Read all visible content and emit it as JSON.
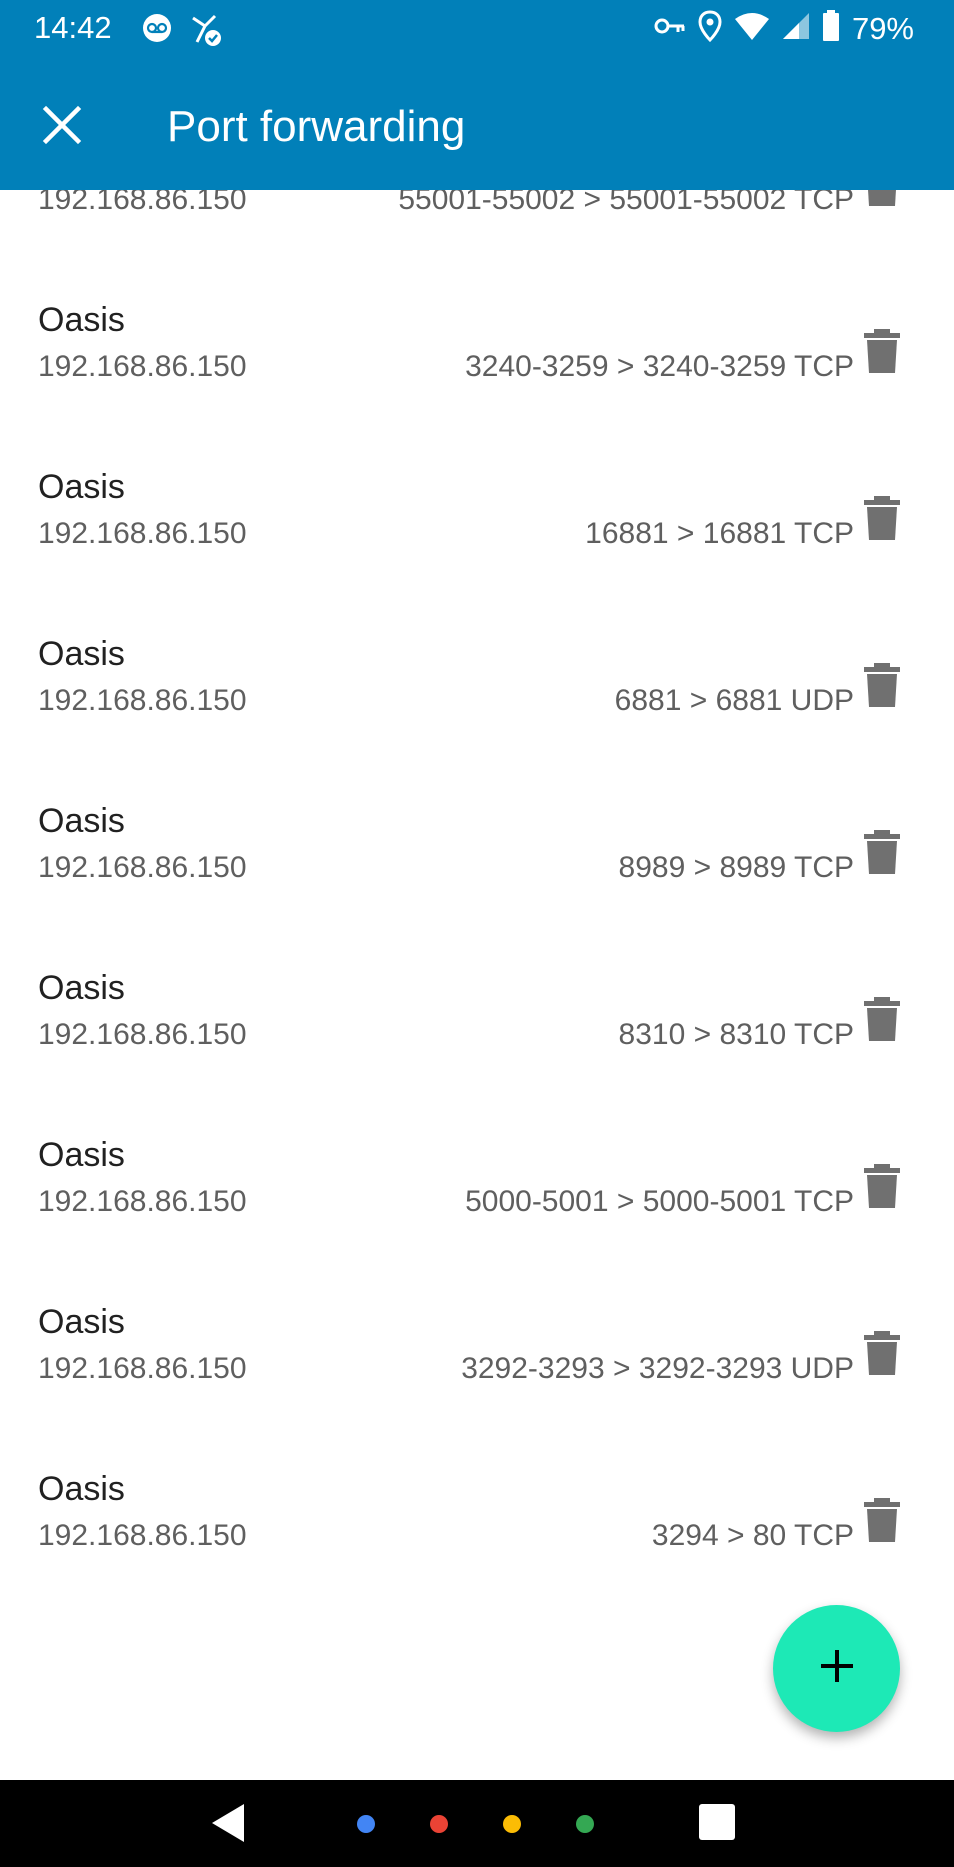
{
  "status_bar": {
    "time": "14:42",
    "battery_text": "79%",
    "icons_left": [
      "voicemail-icon",
      "vpn-share-icon"
    ],
    "icons_right": [
      "vpn-key-icon",
      "location-icon",
      "wifi-icon",
      "signal-icon",
      "battery-icon"
    ]
  },
  "app_bar": {
    "title": "Port forwarding",
    "close_icon": "close-icon",
    "background_color": "#0180b9"
  },
  "rules": [
    {
      "name": "",
      "ip": "192.168.86.150",
      "rule": "55001-55002 > 55001-55002 TCP"
    },
    {
      "name": "Oasis",
      "ip": "192.168.86.150",
      "rule": "3240-3259 > 3240-3259 TCP"
    },
    {
      "name": "Oasis",
      "ip": "192.168.86.150",
      "rule": "16881 > 16881 TCP"
    },
    {
      "name": "Oasis",
      "ip": "192.168.86.150",
      "rule": "6881 > 6881 UDP"
    },
    {
      "name": "Oasis",
      "ip": "192.168.86.150",
      "rule": "8989 > 8989 TCP"
    },
    {
      "name": "Oasis",
      "ip": "192.168.86.150",
      "rule": "8310 > 8310 TCP"
    },
    {
      "name": "Oasis",
      "ip": "192.168.86.150",
      "rule": "5000-5001 > 5000-5001 TCP"
    },
    {
      "name": "Oasis",
      "ip": "192.168.86.150",
      "rule": "3292-3293 > 3292-3293 UDP"
    },
    {
      "name": "Oasis",
      "ip": "192.168.86.150",
      "rule": "3294 > 80 TCP"
    }
  ],
  "fab": {
    "icon": "plus-icon",
    "color": "#1de9b6"
  },
  "nav_bar": {
    "icons": [
      "back-icon",
      "home-dots-icon",
      "recents-icon"
    ],
    "dot_colors": [
      "#4285f4",
      "#ea4335",
      "#fbbc05",
      "#34a853"
    ]
  }
}
